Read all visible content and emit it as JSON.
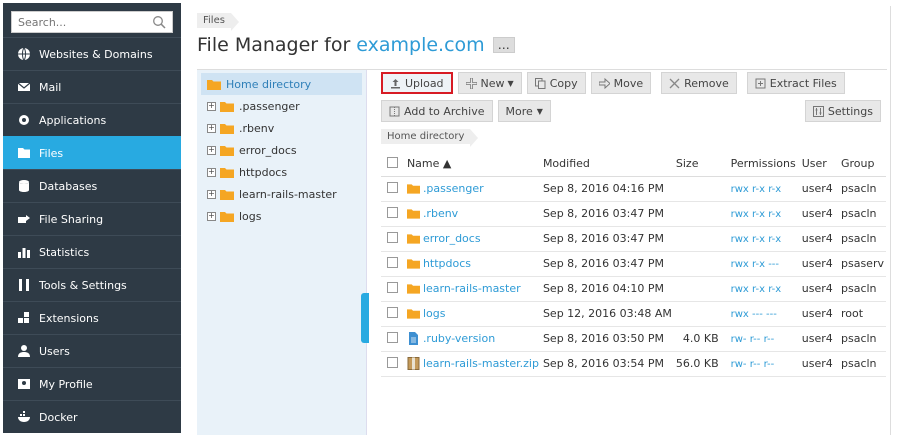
{
  "search": {
    "placeholder": "Search..."
  },
  "sidebar": {
    "items": [
      {
        "label": "Websites & Domains",
        "icon": "globe-icon"
      },
      {
        "label": "Mail",
        "icon": "mail-icon"
      },
      {
        "label": "Applications",
        "icon": "gear-icon"
      },
      {
        "label": "Files",
        "icon": "folder-icon",
        "active": true
      },
      {
        "label": "Databases",
        "icon": "database-icon"
      },
      {
        "label": "File Sharing",
        "icon": "share-icon"
      },
      {
        "label": "Statistics",
        "icon": "bar-chart-icon"
      },
      {
        "label": "Tools & Settings",
        "icon": "tools-icon"
      },
      {
        "label": "Extensions",
        "icon": "extensions-icon"
      },
      {
        "label": "Users",
        "icon": "user-icon"
      },
      {
        "label": "My Profile",
        "icon": "profile-icon"
      },
      {
        "label": "Docker",
        "icon": "docker-icon"
      }
    ]
  },
  "breadcrumb": {
    "label": "Files"
  },
  "header": {
    "title": "File Manager for",
    "domain": "example.com",
    "more": "…"
  },
  "tree": {
    "root": "Home directory",
    "items": [
      ".passenger",
      ".rbenv",
      "error_docs",
      "httpdocs",
      "learn-rails-master",
      "logs"
    ]
  },
  "toolbar": {
    "upload": "Upload",
    "new": "New",
    "copy": "Copy",
    "move": "Move",
    "remove": "Remove",
    "extract": "Extract Files",
    "archive": "Add to Archive",
    "more": "More",
    "settings": "Settings"
  },
  "path": {
    "label": "Home directory"
  },
  "table": {
    "headers": {
      "name": "Name ▲",
      "modified": "Modified",
      "size": "Size",
      "permissions": "Permissions",
      "user": "User",
      "group": "Group"
    },
    "rows": [
      {
        "name": ".passenger",
        "type": "folder",
        "modified": "Sep 8, 2016 04:16 PM",
        "size": "",
        "permissions": "rwx r-x r-x",
        "user": "user4",
        "group": "psacln"
      },
      {
        "name": ".rbenv",
        "type": "folder",
        "modified": "Sep 8, 2016 03:47 PM",
        "size": "",
        "permissions": "rwx r-x r-x",
        "user": "user4",
        "group": "psacln"
      },
      {
        "name": "error_docs",
        "type": "folder",
        "modified": "Sep 8, 2016 03:47 PM",
        "size": "",
        "permissions": "rwx r-x r-x",
        "user": "user4",
        "group": "psacln"
      },
      {
        "name": "httpdocs",
        "type": "folder",
        "modified": "Sep 8, 2016 03:47 PM",
        "size": "",
        "permissions": "rwx r-x ---",
        "user": "user4",
        "group": "psaserv"
      },
      {
        "name": "learn-rails-master",
        "type": "folder",
        "modified": "Sep 8, 2016 04:10 PM",
        "size": "",
        "permissions": "rwx r-x r-x",
        "user": "user4",
        "group": "psacln"
      },
      {
        "name": "logs",
        "type": "folder",
        "modified": "Sep 12, 2016 03:48 AM",
        "size": "",
        "permissions": "rwx --- ---",
        "user": "user4",
        "group": "root"
      },
      {
        "name": ".ruby-version",
        "type": "file",
        "modified": "Sep 8, 2016 03:50 PM",
        "size": "4.0 KB",
        "permissions": "rw- r-- r--",
        "user": "user4",
        "group": "psacln"
      },
      {
        "name": "learn-rails-master.zip",
        "type": "archive",
        "modified": "Sep 8, 2016 03:54 PM",
        "size": "56.0 KB",
        "permissions": "rw- r-- r--",
        "user": "user4",
        "group": "psacln"
      }
    ]
  },
  "colors": {
    "accent": "#28aae1",
    "sidebar": "#2e3a45",
    "link": "#2e9bd6",
    "highlight": "#d71b24",
    "folder": "#f5a623"
  }
}
